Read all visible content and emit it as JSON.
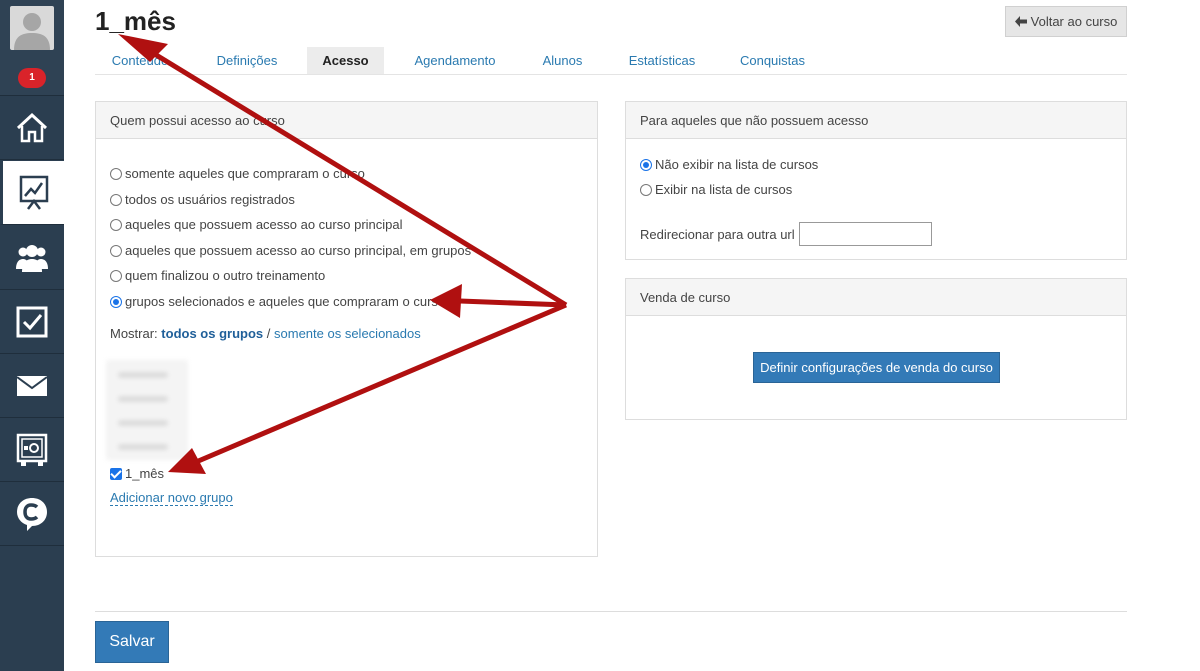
{
  "sidebar": {
    "badge_count": "1",
    "items": [
      {
        "name": "home",
        "icon": "home-icon"
      },
      {
        "name": "courses",
        "icon": "chart-board-icon",
        "active": true
      },
      {
        "name": "users",
        "icon": "users-icon"
      },
      {
        "name": "tasks",
        "icon": "checkbox-icon"
      },
      {
        "name": "messages",
        "icon": "envelope-icon"
      },
      {
        "name": "settings",
        "icon": "safe-icon"
      },
      {
        "name": "chat",
        "icon": "chat-c-icon"
      }
    ]
  },
  "header": {
    "title": "1_mês",
    "back_label": "Voltar ao curso"
  },
  "tabs": [
    {
      "label": "Conteúdo"
    },
    {
      "label": "Definições"
    },
    {
      "label": "Acesso",
      "active": true
    },
    {
      "label": "Agendamento"
    },
    {
      "label": "Alunos"
    },
    {
      "label": "Estatísticas"
    },
    {
      "label": "Conquistas"
    }
  ],
  "access_panel": {
    "title": "Quem possui acesso ao curso",
    "options": [
      "somente aqueles que compraram o curso",
      "todos os usuários registrados",
      "aqueles que possuem acesso ao curso principal",
      "aqueles que possuem acesso ao curso principal, em grupos",
      "quem finalizou o outro treinamento",
      "grupos selecionados e aqueles que compraram o curso"
    ],
    "selected_index": 5,
    "show_label": "Mostrar:",
    "show_all": "todos os grupos",
    "show_separator": "/",
    "show_selected": "somente os selecionados",
    "group_checked": "1_mês",
    "add_group": "Adicionar novo grupo"
  },
  "no_access_panel": {
    "title": "Para aqueles que não possuem acesso",
    "options": [
      "Não exibir na lista de cursos",
      "Exibir na lista de cursos"
    ],
    "selected_index": 0,
    "redirect_label": "Redirecionar para outra url",
    "redirect_value": ""
  },
  "sale_panel": {
    "title": "Venda de curso",
    "button_label": "Definir configurações de venda do curso"
  },
  "footer": {
    "save_label": "Salvar"
  },
  "colors": {
    "sidebar_bg": "#2b3e50",
    "primary": "#337ab7",
    "link": "#2a7ab0",
    "badge": "#d9232a",
    "annotation_arrow": "#b01010"
  }
}
